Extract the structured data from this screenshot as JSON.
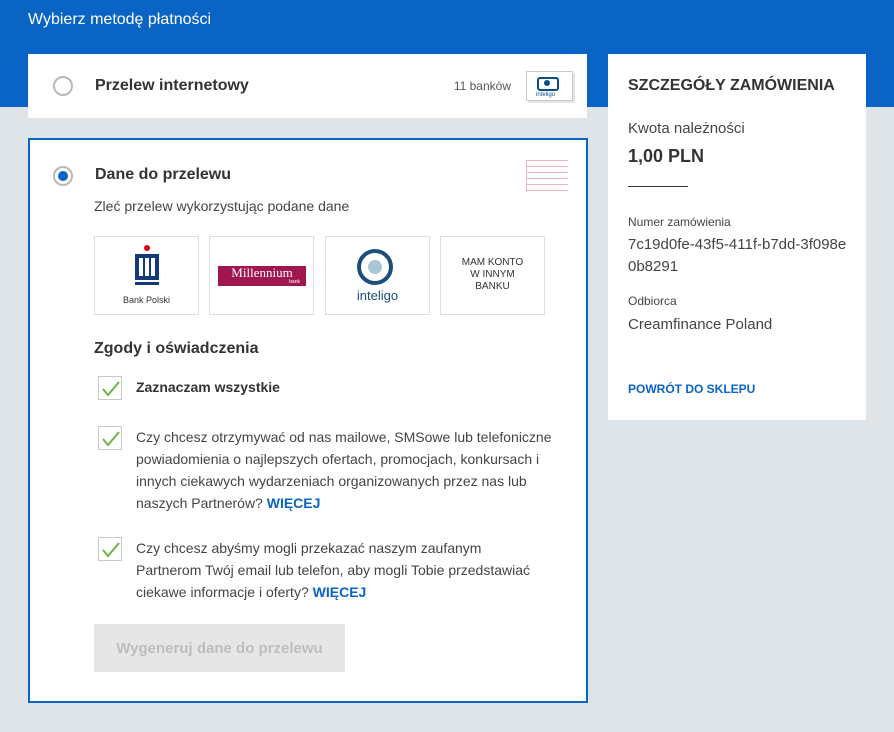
{
  "header": {
    "title": "Wybierz metodę płatności"
  },
  "online_transfer": {
    "label": "Przelew internetowy",
    "bank_count": "11 banków",
    "thumb_text": "inteligo"
  },
  "bank_transfer": {
    "label": "Dane do przelewu",
    "subtitle": "Zleć przelew wykorzystując podane dane",
    "banks": [
      {
        "name": "Bank Polski"
      },
      {
        "name": "Millennium",
        "sub": "bank"
      },
      {
        "name": "inteligo"
      },
      {
        "name": "MAM KONTO W INNYM BANKU"
      }
    ],
    "consents_title": "Zgody i oświadczenia",
    "consents": [
      {
        "text": "Zaznaczam wszystkie"
      },
      {
        "text": "Czy chcesz otrzymywać od nas mailowe, SMSowe lub telefoniczne powiadomienia o najlepszych ofertach, promocjach, konkursach i innych ciekawych wydarzeniach organizowanych przez nas lub naszych Partnerów?",
        "link": "WIĘCEJ"
      },
      {
        "text": "Czy chcesz abyśmy mogli przekazać naszym zaufanym Partnerom Twój email lub telefon, aby mogli Tobie przedstawiać ciekawe informacje i oferty?",
        "link": "WIĘCEJ"
      }
    ],
    "generate_button": "Wygeneruj dane do przelewu"
  },
  "summary": {
    "title": "SZCZEGÓŁY ZAMÓWIENIA",
    "amount_label": "Kwota należności",
    "amount": "1,00 PLN",
    "order_label": "Numer zamówienia",
    "order_number": "7c19d0fe-43f5-411f-b7dd-3f098e0b8291",
    "recipient_label": "Odbiorca",
    "recipient": "Creamfinance Poland",
    "back_link": "POWRÓT DO SKLEPU"
  },
  "colors": {
    "brand_blue": "#0a64c4",
    "checkmark_green": "#6cb33f",
    "millennium": "#a0164e"
  }
}
